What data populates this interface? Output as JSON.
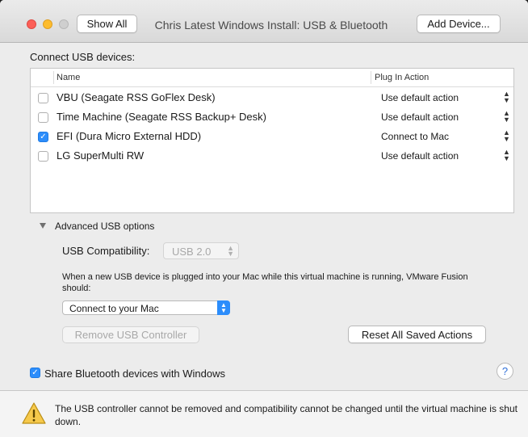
{
  "window": {
    "title": "Chris Latest Windows Install: USB & Bluetooth",
    "show_all_label": "Show All",
    "add_device_label": "Add Device..."
  },
  "usb": {
    "section_label": "Connect USB devices:",
    "columns": [
      "Name",
      "Plug In Action"
    ],
    "devices": [
      {
        "name": "VBU (Seagate RSS GoFlex Desk)",
        "action": "Use default action",
        "checked": false
      },
      {
        "name": "Time Machine (Seagate RSS Backup+ Desk)",
        "action": "Use default action",
        "checked": false
      },
      {
        "name": "EFI (Dura Micro External HDD)",
        "action": "Connect to Mac",
        "checked": true
      },
      {
        "name": "LG SuperMulti RW",
        "action": "Use default action",
        "checked": false
      }
    ]
  },
  "advanced": {
    "label": "Advanced USB options",
    "compat_label": "USB Compatibility:",
    "compat_value": "USB 2.0",
    "plug_text": "When a new USB device is plugged into your Mac while this virtual machine is running, VMware Fusion should:",
    "plug_value": "Connect to your Mac",
    "remove_label": "Remove USB Controller",
    "reset_label": "Reset All Saved Actions"
  },
  "bluetooth": {
    "label": "Share Bluetooth devices with Windows",
    "checked": true
  },
  "help_label": "?",
  "footer": {
    "warning": "The USB controller cannot be removed and compatibility cannot be changed until the virtual machine is shut down."
  },
  "colors": {
    "accent": "#2c8dfb",
    "close": "#fc5f57",
    "minimize": "#fdbc2e"
  },
  "icons": {
    "warning": "warning-triangle-icon",
    "disclosure": "disclosure-triangle-icon"
  }
}
